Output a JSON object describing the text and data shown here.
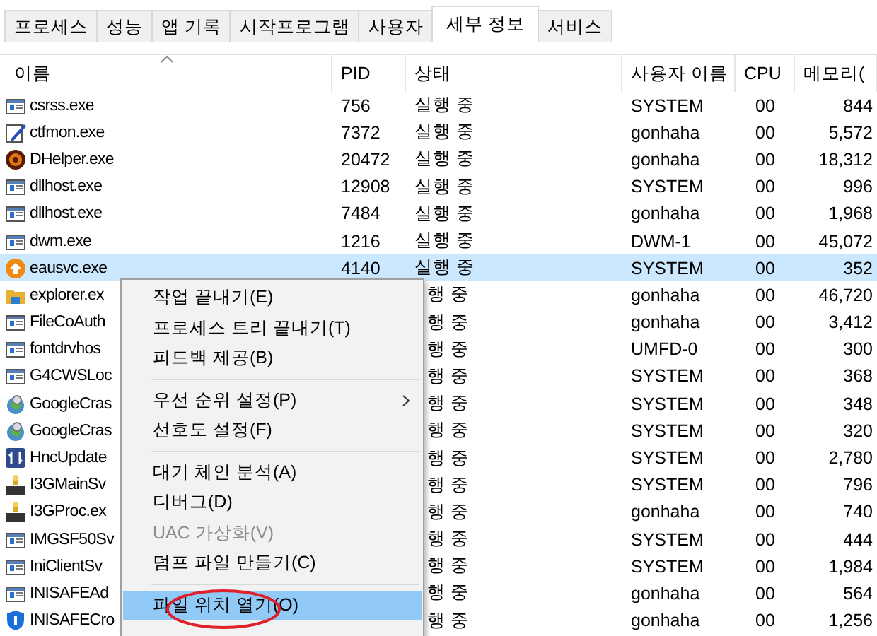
{
  "tabs": [
    {
      "label": "프로세스",
      "selected": false
    },
    {
      "label": "성능",
      "selected": false
    },
    {
      "label": "앱 기록",
      "selected": false
    },
    {
      "label": "시작프로그램",
      "selected": false
    },
    {
      "label": "사용자",
      "selected": false
    },
    {
      "label": "세부 정보",
      "selected": true
    },
    {
      "label": "서비스",
      "selected": false
    }
  ],
  "table": {
    "columns": [
      "이름",
      "PID",
      "상태",
      "사용자 이름",
      "CPU",
      "메모리("
    ],
    "rows": [
      {
        "kind": "window",
        "name": "csrss.exe",
        "pid": "756",
        "status": "실행 중",
        "user": "SYSTEM",
        "cpu": "00",
        "memory": "844",
        "selected": false
      },
      {
        "kind": "pen",
        "name": "ctfmon.exe",
        "pid": "7372",
        "status": "실행 중",
        "user": "gonhaha",
        "cpu": "00",
        "memory": "5,572",
        "selected": false
      },
      {
        "kind": "disc",
        "name": "DHelper.exe",
        "pid": "20472",
        "status": "실행 중",
        "user": "gonhaha",
        "cpu": "00",
        "memory": "18,312",
        "selected": false
      },
      {
        "kind": "window",
        "name": "dllhost.exe",
        "pid": "12908",
        "status": "실행 중",
        "user": "SYSTEM",
        "cpu": "00",
        "memory": "996",
        "selected": false
      },
      {
        "kind": "window",
        "name": "dllhost.exe",
        "pid": "7484",
        "status": "실행 중",
        "user": "gonhaha",
        "cpu": "00",
        "memory": "1,968",
        "selected": false
      },
      {
        "kind": "window",
        "name": "dwm.exe",
        "pid": "1216",
        "status": "실행 중",
        "user": "DWM-1",
        "cpu": "00",
        "memory": "45,072",
        "selected": false
      },
      {
        "kind": "upload",
        "name": "eausvc.exe",
        "pid": "4140",
        "status": "실행 중",
        "user": "SYSTEM",
        "cpu": "00",
        "memory": "352",
        "selected": true
      },
      {
        "kind": "folder",
        "name": "explorer.ex",
        "status": "행 중",
        "user": "gonhaha",
        "cpu": "00",
        "memory": "46,720",
        "selected": false
      },
      {
        "kind": "window",
        "name": "FileCoAuth",
        "status": "행 중",
        "user": "gonhaha",
        "cpu": "00",
        "memory": "3,412",
        "selected": false
      },
      {
        "kind": "window",
        "name": "fontdrvhos",
        "status": "행 중",
        "user": "UMFD-0",
        "cpu": "00",
        "memory": "300",
        "selected": false
      },
      {
        "kind": "window",
        "name": "G4CWSLoc",
        "status": "행 중",
        "user": "SYSTEM",
        "cpu": "00",
        "memory": "368",
        "selected": false
      },
      {
        "kind": "globe",
        "name": "GoogleCras",
        "status": "행 중",
        "user": "SYSTEM",
        "cpu": "00",
        "memory": "348",
        "selected": false
      },
      {
        "kind": "globe",
        "name": "GoogleCras",
        "status": "행 중",
        "user": "SYSTEM",
        "cpu": "00",
        "memory": "320",
        "selected": false
      },
      {
        "kind": "update",
        "name": "HncUpdate",
        "status": "행 중",
        "user": "SYSTEM",
        "cpu": "00",
        "memory": "2,780",
        "selected": false
      },
      {
        "kind": "keys",
        "name": "I3GMainSv",
        "status": "행 중",
        "user": "SYSTEM",
        "cpu": "00",
        "memory": "796",
        "selected": false
      },
      {
        "kind": "keys",
        "name": "I3GProc.ex",
        "status": "행 중",
        "user": "gonhaha",
        "cpu": "00",
        "memory": "740",
        "selected": false
      },
      {
        "kind": "window",
        "name": "IMGSF50Sv",
        "status": "행 중",
        "user": "SYSTEM",
        "cpu": "00",
        "memory": "444",
        "selected": false
      },
      {
        "kind": "window",
        "name": "IniClientSv",
        "status": "행 중",
        "user": "SYSTEM",
        "cpu": "00",
        "memory": "1,984",
        "selected": false
      },
      {
        "kind": "window",
        "name": "INISAFEAd",
        "status": "행 중",
        "user": "gonhaha",
        "cpu": "00",
        "memory": "564",
        "selected": false
      },
      {
        "kind": "shield",
        "name": "INISAFECro",
        "status": "행 중",
        "user": "gonhaha",
        "cpu": "00",
        "memory": "1,256",
        "selected": false
      }
    ]
  },
  "context_menu": [
    {
      "kind": "item",
      "label": "작업 끝내기(E)",
      "selected": false,
      "disabled": false,
      "submenu": false
    },
    {
      "kind": "item",
      "label": "프로세스 트리 끝내기(T)",
      "selected": false,
      "disabled": false,
      "submenu": false
    },
    {
      "kind": "item",
      "label": "피드백 제공(B)",
      "selected": false,
      "disabled": false,
      "submenu": false
    },
    {
      "kind": "separator"
    },
    {
      "kind": "item",
      "label": "우선 순위 설정(P)",
      "selected": false,
      "disabled": false,
      "submenu": true
    },
    {
      "kind": "item",
      "label": "선호도 설정(F)",
      "selected": false,
      "disabled": false,
      "submenu": false
    },
    {
      "kind": "separator"
    },
    {
      "kind": "item",
      "label": "대기 체인 분석(A)",
      "selected": false,
      "disabled": false,
      "submenu": false
    },
    {
      "kind": "item",
      "label": "디버그(D)",
      "selected": false,
      "disabled": false,
      "submenu": false
    },
    {
      "kind": "item",
      "label": "UAC 가상화(V)",
      "selected": false,
      "disabled": true,
      "submenu": false
    },
    {
      "kind": "item",
      "label": "덤프 파일 만들기(C)",
      "selected": false,
      "disabled": false,
      "submenu": false
    },
    {
      "kind": "separator"
    },
    {
      "kind": "item",
      "label": "파일 위치 열기(O)",
      "selected": true,
      "disabled": false,
      "submenu": false
    }
  ]
}
